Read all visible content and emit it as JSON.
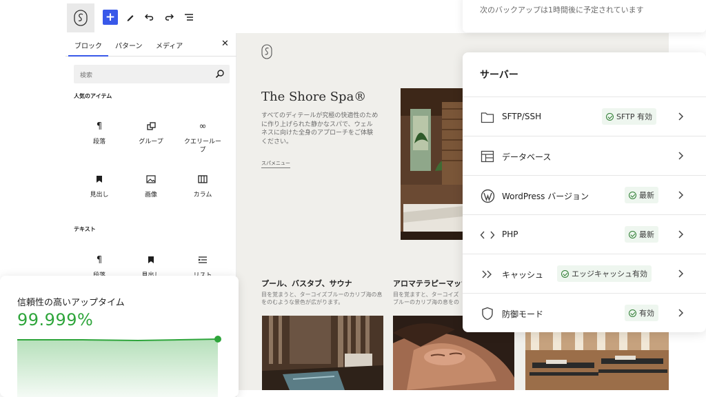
{
  "editor": {
    "tabs": [
      "ブロック",
      "パターン",
      "メディア"
    ],
    "search_placeholder": "検索",
    "popular_section": "人気のアイテム",
    "text_section": "テキスト",
    "popular_blocks": [
      {
        "label": "段落",
        "icon": "paragraph-icon"
      },
      {
        "label": "グループ",
        "icon": "group-icon"
      },
      {
        "label": "クエリールー\nプ",
        "icon": "query-loop-icon"
      },
      {
        "label": "見出し",
        "icon": "heading-icon"
      },
      {
        "label": "画像",
        "icon": "image-icon"
      },
      {
        "label": "カラム",
        "icon": "columns-icon"
      }
    ],
    "text_blocks": [
      {
        "label": "段落",
        "icon": "paragraph-icon"
      },
      {
        "label": "見出し",
        "icon": "heading-icon"
      },
      {
        "label": "リスト",
        "icon": "list-icon"
      }
    ]
  },
  "canvas": {
    "site_title": "The Shore Spa®",
    "site_desc": "すべてのディテールが究極の快適性のために作り上げられた静かなスパで、ウェルネスに向けた全身のアプローチをご体験ください。",
    "menu_link": "スパメニュー",
    "features": [
      {
        "title": "プール、バスタブ、サウナ",
        "desc": "目を覚まうと、ターコイズブルーのカリブ海の息をのむような景色が広がります。"
      },
      {
        "title": "アロマテラピーマッサージ",
        "desc": "目を覚ますと、ターコイズブルーのカリブ海の息をのむような景色が広がります。"
      }
    ]
  },
  "uptime": {
    "title": "信頼性の高いアップタイム",
    "value": "99.999%",
    "accent": "#2ea53b"
  },
  "backup": {
    "text": "次のバックアップは1時間後に予定されています"
  },
  "server": {
    "title": "サーバー",
    "rows": [
      {
        "label": "SFTP/SSH",
        "badge": "SFTP 有効",
        "icon": "folder-icon"
      },
      {
        "label": "データベース",
        "badge": "",
        "icon": "table-icon"
      },
      {
        "label": "WordPress バージョン",
        "badge": "最新",
        "icon": "wordpress-icon"
      },
      {
        "label": "PHP",
        "badge": "最新",
        "icon": "code-icon"
      },
      {
        "label": "キャッシュ",
        "badge": "エッジキャッシュ有効",
        "icon": "double-chevron-icon"
      },
      {
        "label": "防御モード",
        "badge": "有効",
        "icon": "shield-icon"
      }
    ]
  }
}
